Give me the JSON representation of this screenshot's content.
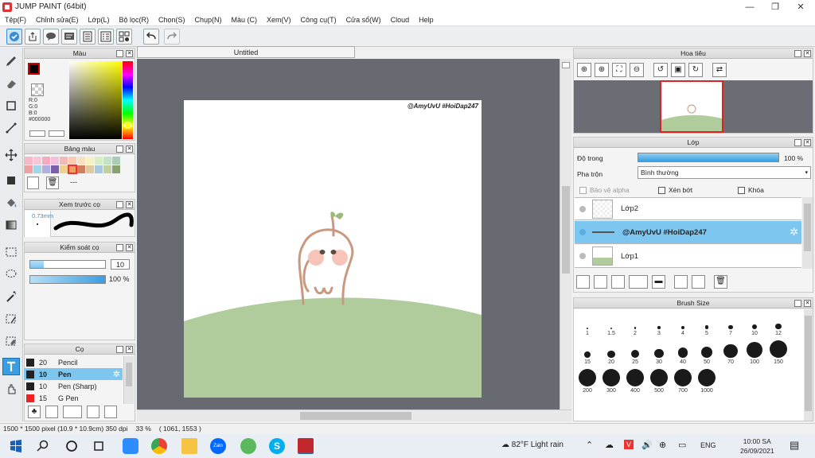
{
  "window": {
    "title": "JUMP PAINT (64bit)"
  },
  "menu": [
    "Tệp(F)",
    "Chỉnh sửa(E)",
    "Lớp(L)",
    "Bộ lọc(R)",
    "Chọn(S)",
    "Chụp(N)",
    "Màu (C)",
    "Xem(V)",
    "Công cụ(T)",
    "Cửa sổ(W)",
    "Cloud",
    "Help"
  ],
  "document": {
    "tab_title": "Untitled",
    "watermark": "@AmyUvU #HoiDap247"
  },
  "color_panel": {
    "title": "Màu",
    "r": "R:0",
    "g": "G:0",
    "b": "B:0",
    "hex": "#000000",
    "fg": "#000000",
    "accent": "#d11"
  },
  "swatch_panel": {
    "title": "Bảng màu",
    "dash": "---",
    "row1": [
      "#f4b8c8",
      "#f9c6d8",
      "#f7a9c0",
      "#f2c0d8",
      "#f4b6b8",
      "#f8cdb4",
      "#f9e0c0",
      "#f5f1c4",
      "#d9eec0",
      "#c4e2c8",
      "#a8cdb4"
    ],
    "row2": [
      "#f0a0a0",
      "#9fd6e8",
      "#b0b0e0",
      "#7b5fa8",
      "#f0d090",
      "#f0a060",
      "#d08060",
      "#e0c8a0",
      "#a8c8e0",
      "#c0d0a0",
      "#8aa070"
    ]
  },
  "brush_preview": {
    "title": "Xem trước cọ",
    "size": "0.73mm"
  },
  "brush_control": {
    "title": "Kiểm soát cọ",
    "size_value": "10",
    "opacity_value": "100 %"
  },
  "brush_list": {
    "title": "Cọ",
    "items": [
      {
        "size": "20",
        "name": "Pencil",
        "color": "#222",
        "selected": false
      },
      {
        "size": "10",
        "name": "Pen",
        "color": "#222",
        "selected": true
      },
      {
        "size": "10",
        "name": "Pen (Sharp)",
        "color": "#222",
        "selected": false
      },
      {
        "size": "15",
        "name": "G Pen",
        "color": "#e22",
        "selected": false
      }
    ]
  },
  "navigator": {
    "title": "Hoa tiêu"
  },
  "layer_panel": {
    "title": "Lớp",
    "opacity_label": "Độ trong",
    "opacity_value": "100 %",
    "blend_label": "Pha trộn",
    "blend_value": "Bình thường",
    "protect_alpha": "Bảo vệ alpha",
    "clipping": "Xén bớt",
    "lock": "Khóa",
    "layers": [
      {
        "name": "Lớp2",
        "selected": false
      },
      {
        "name": "@AmyUvU #HoiDap247",
        "selected": true
      },
      {
        "name": "Lớp1",
        "selected": false
      }
    ]
  },
  "brush_size_panel": {
    "title": "Brush Size",
    "sizes": [
      "1",
      "1.5",
      "2",
      "3",
      "4",
      "5",
      "7",
      "10",
      "12",
      "15",
      "20",
      "25",
      "30",
      "40",
      "50",
      "70",
      "100",
      "150",
      "200",
      "300",
      "400",
      "500",
      "700",
      "1000"
    ]
  },
  "status": {
    "dims": "1500 * 1500 pixel",
    "mm": "(10.9 * 10.9cm)",
    "dpi": "350 dpi",
    "zoom": "33 %",
    "coords": "( 1061, 1553 )"
  },
  "taskbar": {
    "weather": "82°F  Light rain",
    "lang": "ENG",
    "time": "10:00 SA",
    "date": "26/09/2021"
  }
}
